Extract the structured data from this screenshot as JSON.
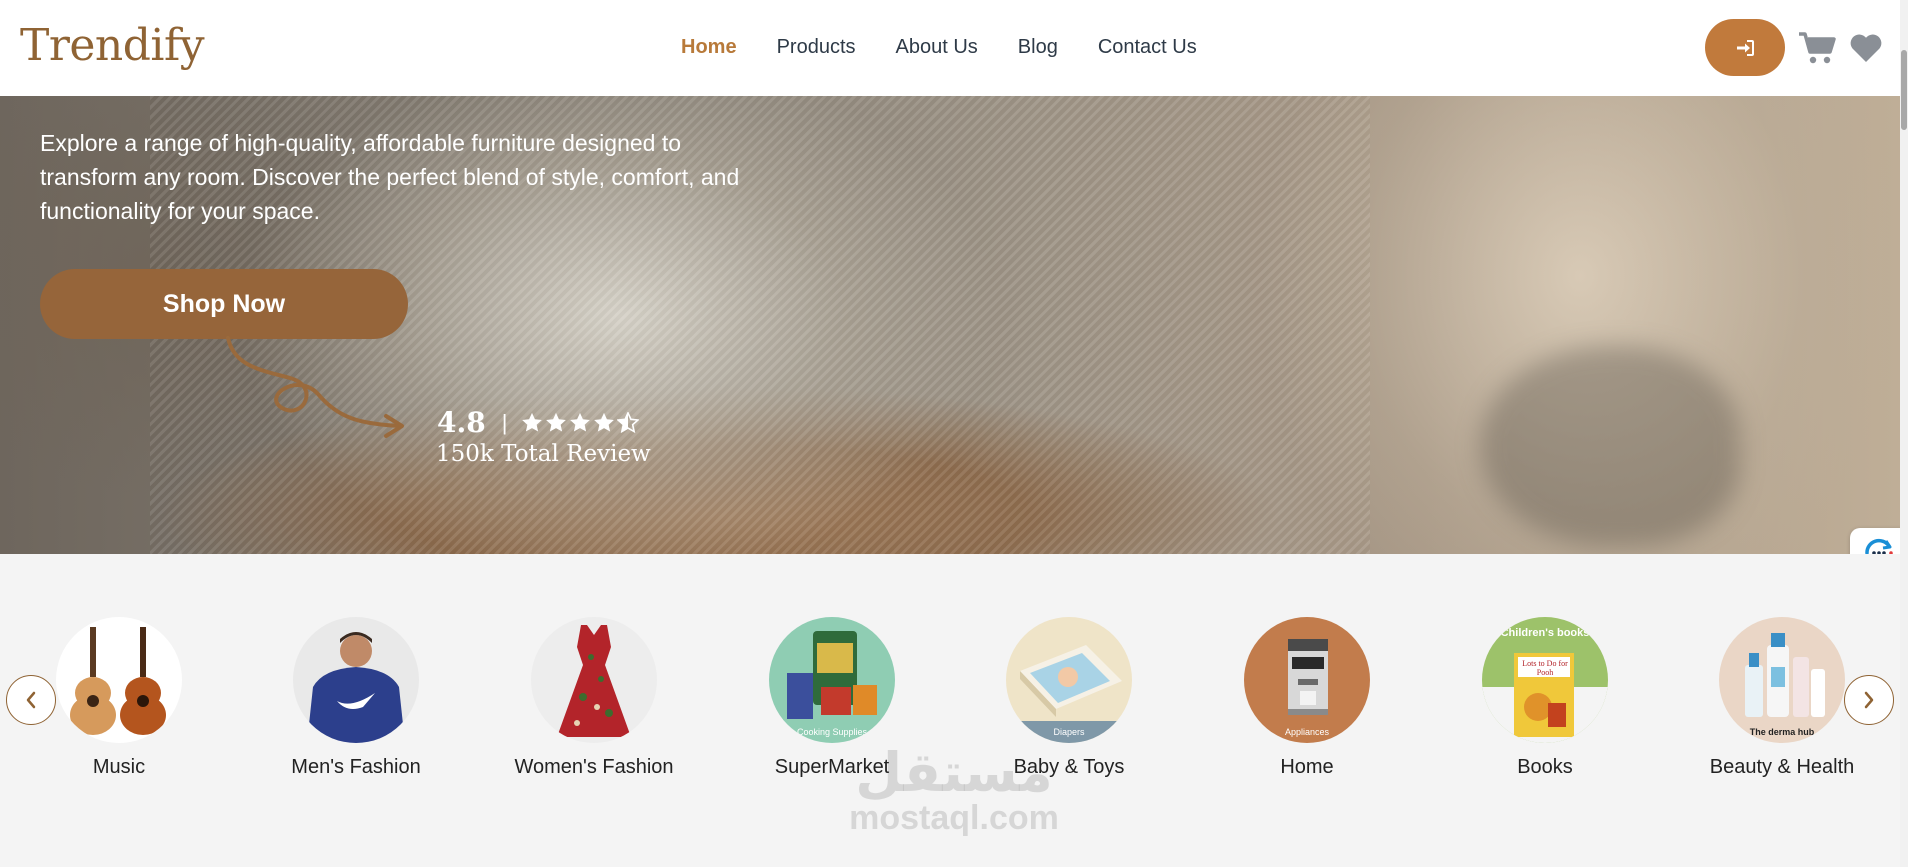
{
  "brand": {
    "name": "Trendify",
    "accent_color": "#b87a3a",
    "button_color": "#c17a3c"
  },
  "nav": {
    "items": [
      {
        "label": "Home",
        "active": true
      },
      {
        "label": "Products",
        "active": false
      },
      {
        "label": "About Us",
        "active": false
      },
      {
        "label": "Blog",
        "active": false
      },
      {
        "label": "Contact Us",
        "active": false
      }
    ]
  },
  "header_icons": {
    "login": "sign-in-icon",
    "cart": "cart-icon",
    "wishlist": "heart-icon"
  },
  "hero": {
    "description": "Explore a range of high-quality, affordable furniture designed to transform any room. Discover the perfect blend of style, comfort, and functionality for your space.",
    "cta_label": "Shop Now",
    "rating": {
      "value": "4.8",
      "separator": "|",
      "stars": 4.5,
      "reviews": "150k Total Review"
    }
  },
  "categories": {
    "items": [
      {
        "label": "Music",
        "icon": "guitar-image"
      },
      {
        "label": "Men's Fashion",
        "icon": "hoodie-image"
      },
      {
        "label": "Women's Fashion",
        "icon": "dress-image"
      },
      {
        "label": "SuperMarket",
        "icon": "groceries-image",
        "tag": "Cooking Supplies"
      },
      {
        "label": "Baby & Toys",
        "icon": "diapers-image",
        "tag": "Diapers"
      },
      {
        "label": "Home",
        "icon": "coffee-machine-image",
        "tag": "Appliances"
      },
      {
        "label": "Books",
        "icon": "book-image",
        "tag": "Children's books",
        "book_title": "Lots to Do for Pooh"
      },
      {
        "label": "Beauty & Health",
        "icon": "cosmetics-image",
        "tag": "The derma hub"
      }
    ],
    "prev_icon": "chevron-left-icon",
    "next_icon": "chevron-right-icon"
  },
  "watermark": {
    "arabic": "مستقل",
    "latin": "mostaql.com"
  }
}
